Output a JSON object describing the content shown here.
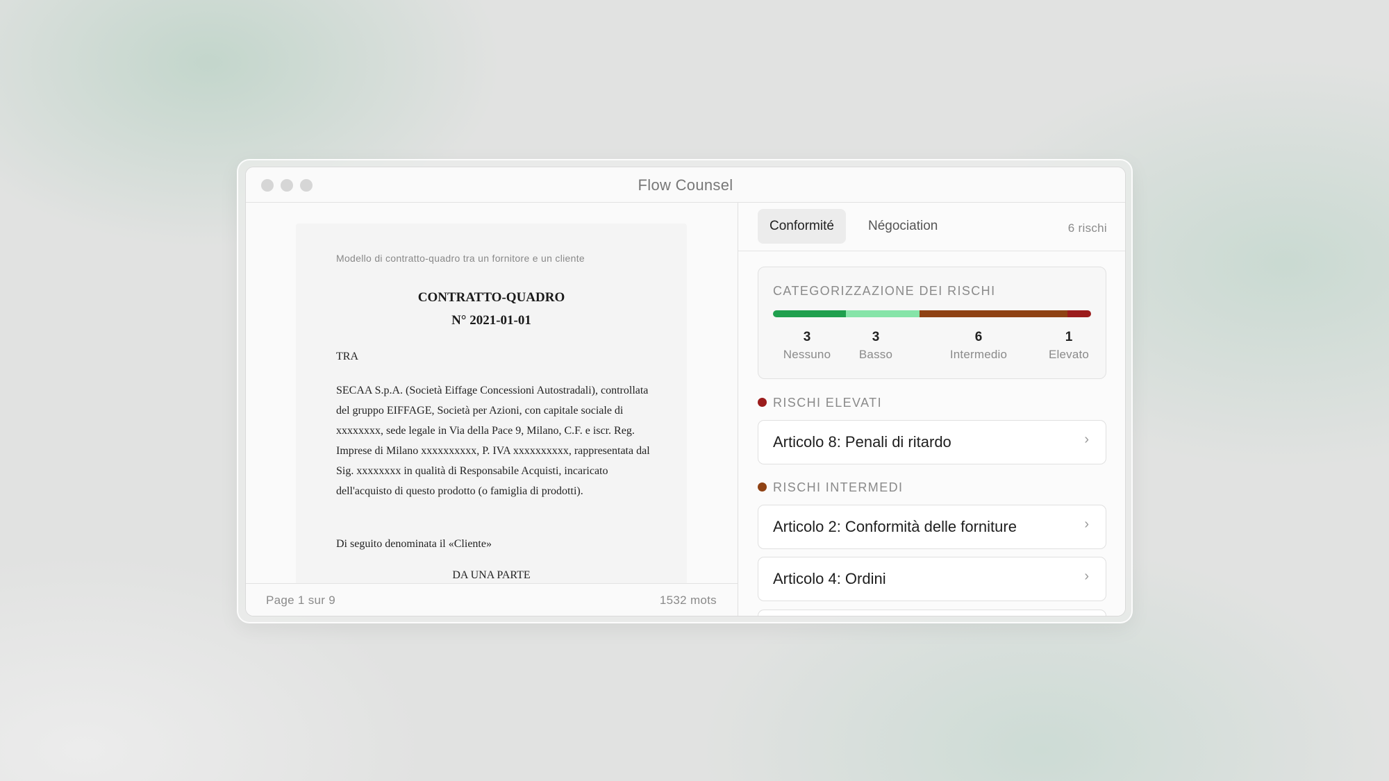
{
  "window": {
    "title": "Flow Counsel"
  },
  "document": {
    "caption": "Modello di contratto-quadro tra un fornitore e un cliente",
    "title_line1": "CONTRATTO-QUADRO",
    "title_line2": "N° 2021-01-01",
    "tra": "TRA",
    "paragraph1": "SECAA S.p.A. (Società Eiffage Concessioni Autostradali), controllata del gruppo EIFFAGE, Società per Azioni, con capitale sociale di xxxxxxxx, sede legale in Via della Pace 9, Milano, C.F. e iscr. Reg. Imprese di Milano xxxxxxxxxx, P. IVA xxxxxxxxxx, rappresentata dal Sig. xxxxxxxx in qualità di Responsabile Acquisti, incaricato dell'acquisto di questo prodotto (o famiglia di prodotti).",
    "paragraph2": "Di seguito denominata il «Cliente»",
    "center_text": "DA UNA PARTE"
  },
  "footer": {
    "page_indicator": "Page 1 sur 9",
    "word_count": "1532 mots"
  },
  "tabs": [
    {
      "label": "Conformité",
      "active": true
    },
    {
      "label": "Négociation",
      "active": false
    }
  ],
  "risk_count": "6 rischi",
  "categorization": {
    "title": "CATEGORIZZAZIONE DEI RISCHI",
    "categories": [
      {
        "count": "3",
        "label": "Nessuno",
        "color": "#20a04e",
        "share": 0.23
      },
      {
        "count": "3",
        "label": "Basso",
        "color": "#86e4a8",
        "share": 0.23
      },
      {
        "count": "6",
        "label": "Intermedio",
        "color": "#8f4214",
        "share": 0.465
      },
      {
        "count": "1",
        "label": "Elevato",
        "color": "#9b1c1c",
        "share": 0.075
      }
    ]
  },
  "sections": {
    "high": {
      "title": "RISCHI ELEVATI",
      "dot_color": "#9b1c1c",
      "items": [
        {
          "label": "Articolo 8: Penali di ritardo"
        }
      ]
    },
    "intermediate": {
      "title": "RISCHI INTERMEDI",
      "dot_color": "#8f4214",
      "items": [
        {
          "label": "Articolo 2: Conformità delle forniture"
        },
        {
          "label": "Articolo 4: Ordini"
        },
        {
          "label": ""
        }
      ]
    }
  },
  "icons": {
    "chevron": "chevron-right-icon"
  }
}
